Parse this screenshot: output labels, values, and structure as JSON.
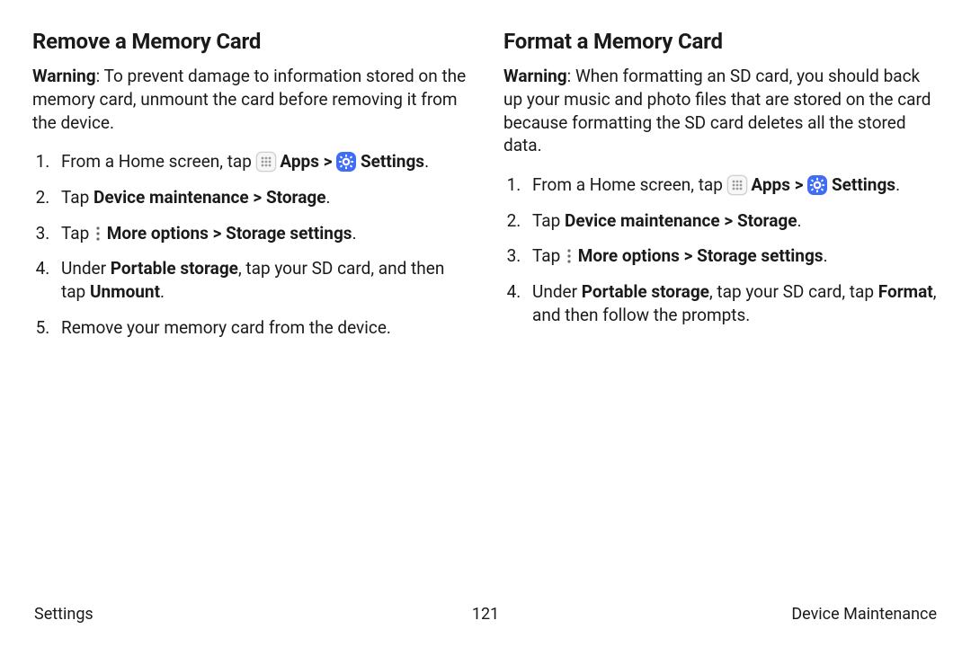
{
  "left": {
    "heading": "Remove a Memory Card",
    "warning_label": "Warning",
    "warning_text": ": To prevent damage to information stored on the memory card, unmount the card before removing it from the device.",
    "step1_pre": "From a Home screen, tap ",
    "apps_label": " Apps",
    "chevron": " > ",
    "settings_label": " Settings",
    "step2_pre": "Tap ",
    "step2_b1": "Device maintenance",
    "step2_b2": "Storage",
    "step3_pre": "Tap ",
    "step3_b1": " More options",
    "step3_b2": "Storage settings",
    "step4_pre": "Under ",
    "step4_b1": "Portable storage",
    "step4_mid": ", tap your SD card, and then tap ",
    "step4_b2": "Unmount",
    "step5": "Remove your memory card from the device."
  },
  "right": {
    "heading": "Format a Memory Card",
    "warning_label": "Warning",
    "warning_text": ": When formatting an SD card, you should back up your music and photo files that are stored on the card because formatting the SD card deletes all the stored data.",
    "step1_pre": "From a Home screen, tap ",
    "apps_label": " Apps",
    "chevron": " > ",
    "settings_label": " Settings",
    "step2_pre": "Tap ",
    "step2_b1": "Device maintenance",
    "step2_b2": "Storage",
    "step3_pre": "Tap ",
    "step3_b1": " More options",
    "step3_b2": "Storage settings",
    "step4_pre": "Under ",
    "step4_b1": "Portable storage",
    "step4_mid": ", tap your SD card, tap ",
    "step4_b2": "Format",
    "step4_end": ", and then follow the prompts."
  },
  "footer": {
    "left": "Settings",
    "center": "121",
    "right": "Device Maintenance"
  },
  "punct": {
    "period": "."
  }
}
